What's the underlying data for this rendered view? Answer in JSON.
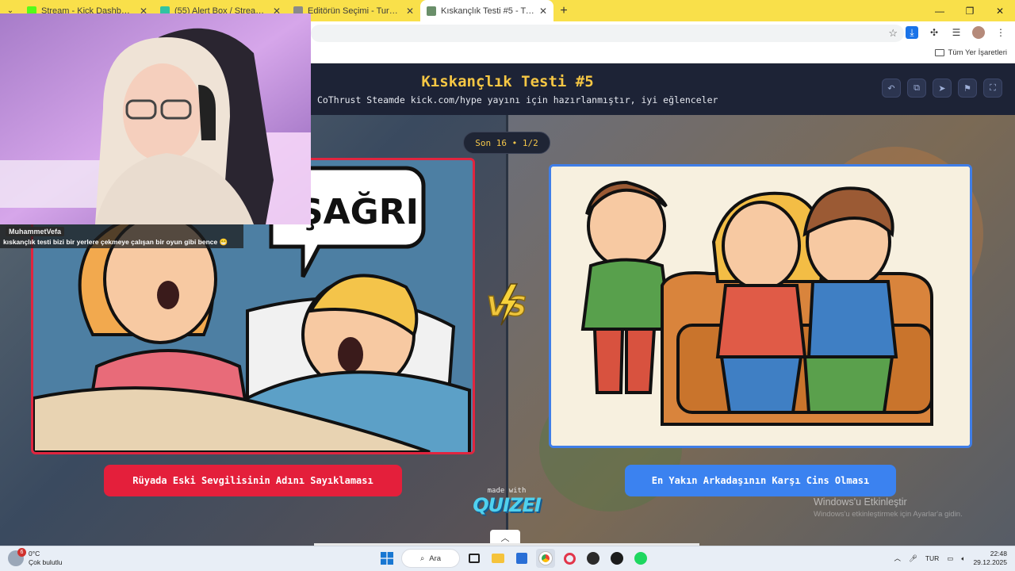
{
  "browser": {
    "tabs": [
      {
        "title": "Stream - Kick Dashboard",
        "favicon_color": "#53fc18"
      },
      {
        "title": "(55) Alert Box / Streamlabs",
        "favicon_color": "#31c3a2"
      },
      {
        "title": "Editörün Seçimi - Turnuva - Qu",
        "favicon_color": "#8a8a8a"
      },
      {
        "title": "Kıskançlık Testi #5 - Tier List, Kı",
        "favicon_color": "#6a8f6a"
      }
    ],
    "new_tab": "+",
    "bookmark_folder": "Tüm Yer İşaretleri"
  },
  "quiz": {
    "title": "Kıskançlık Testi #5",
    "subtitle": "CoThrust Steamde kick.com/hype yayını için hazırlanmıştır, iyi eğlenceler",
    "round": "Son 16 • 1/2",
    "left_option": "Rüyada Eski Sevgilisinin Adını Sayıklaması",
    "right_option": "En Yakın Arkadaşının Karşı Cins Olması",
    "left_bubble": "ŞAĞRI",
    "made_with": "made with",
    "brand": "QUIZEI",
    "vs": "VS"
  },
  "stream": {
    "chat_user": "MuhammetVefa",
    "chat_message": "kıskançlık testi bizi bir yerlere çekmeye çalışan bir oyun gibi bence 😁"
  },
  "windows": {
    "activate_title": "Windows'u Etkinleştir",
    "activate_sub": "Windows'u etkinleştirmek için Ayarlar'a gidin.",
    "weather_badge": "6",
    "temperature": "0°C",
    "weather_desc": "Çok bulutlu",
    "search_label": "Ara",
    "keyboard_lang": "TUR",
    "time": "22:48",
    "date": "29.12.2025"
  },
  "colors": {
    "accent_red": "#e41f3b",
    "accent_blue": "#3b82f0",
    "title_yellow": "#f6c744",
    "chrome_yellow": "#f9e04a"
  }
}
